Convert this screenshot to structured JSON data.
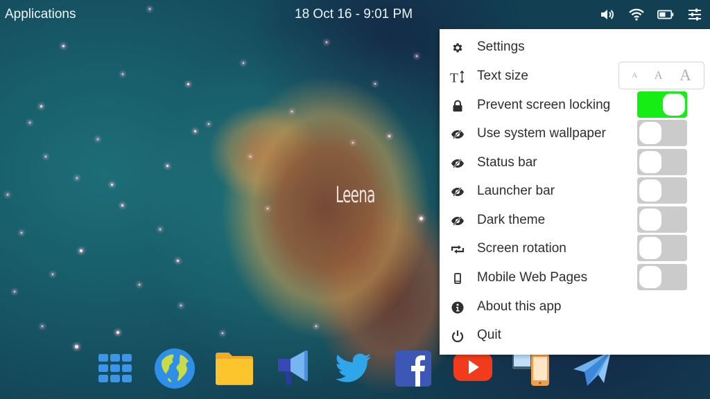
{
  "topbar": {
    "applications_label": "Applications",
    "clock": "18 Oct 16 - 9:01 PM",
    "tray_icons": [
      "volume-icon",
      "wifi-icon",
      "battery-icon",
      "sliders-icon"
    ]
  },
  "wallpaper": {
    "watermark": "Leena"
  },
  "panel": {
    "items": [
      {
        "label": "Settings",
        "icon": "gear-icon"
      },
      {
        "label": "Text size",
        "icon": "text-size-icon",
        "text_size_options": [
          "A",
          "A",
          "A"
        ]
      },
      {
        "label": "Prevent screen locking",
        "icon": "lock-icon",
        "toggle": true
      },
      {
        "label": "Use system wallpaper",
        "icon": "eye-off-icon",
        "toggle": false
      },
      {
        "label": "Status bar",
        "icon": "eye-off-icon",
        "toggle": false
      },
      {
        "label": "Launcher bar",
        "icon": "eye-off-icon",
        "toggle": false
      },
      {
        "label": "Dark theme",
        "icon": "eye-off-icon",
        "toggle": false
      },
      {
        "label": "Screen rotation",
        "icon": "rotate-icon",
        "toggle": false
      },
      {
        "label": "Mobile Web Pages",
        "icon": "phone-icon",
        "toggle": false
      },
      {
        "label": "About this app",
        "icon": "info-icon"
      },
      {
        "label": "Quit",
        "icon": "power-icon"
      }
    ],
    "toggle_on_color": "#14ee14",
    "toggle_off_color": "#cbcbcb"
  },
  "dock": {
    "apps": [
      "app-grid-icon",
      "browser-globe-icon",
      "files-folder-icon",
      "megaphone-icon",
      "twitter-icon",
      "facebook-icon",
      "youtube-icon",
      "devices-icon",
      "paper-plane-icon"
    ]
  }
}
